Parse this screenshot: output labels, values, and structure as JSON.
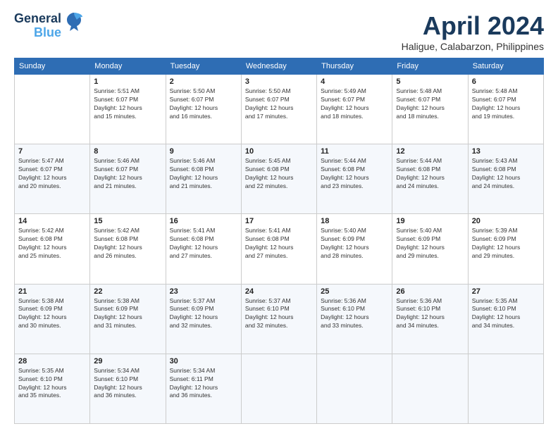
{
  "logo": {
    "line1": "General",
    "line2": "Blue"
  },
  "title": "April 2024",
  "subtitle": "Haligue, Calabarzon, Philippines",
  "headers": [
    "Sunday",
    "Monday",
    "Tuesday",
    "Wednesday",
    "Thursday",
    "Friday",
    "Saturday"
  ],
  "rows": [
    [
      {
        "day": "",
        "info": ""
      },
      {
        "day": "1",
        "info": "Sunrise: 5:51 AM\nSunset: 6:07 PM\nDaylight: 12 hours\nand 15 minutes."
      },
      {
        "day": "2",
        "info": "Sunrise: 5:50 AM\nSunset: 6:07 PM\nDaylight: 12 hours\nand 16 minutes."
      },
      {
        "day": "3",
        "info": "Sunrise: 5:50 AM\nSunset: 6:07 PM\nDaylight: 12 hours\nand 17 minutes."
      },
      {
        "day": "4",
        "info": "Sunrise: 5:49 AM\nSunset: 6:07 PM\nDaylight: 12 hours\nand 18 minutes."
      },
      {
        "day": "5",
        "info": "Sunrise: 5:48 AM\nSunset: 6:07 PM\nDaylight: 12 hours\nand 18 minutes."
      },
      {
        "day": "6",
        "info": "Sunrise: 5:48 AM\nSunset: 6:07 PM\nDaylight: 12 hours\nand 19 minutes."
      }
    ],
    [
      {
        "day": "7",
        "info": "Sunrise: 5:47 AM\nSunset: 6:07 PM\nDaylight: 12 hours\nand 20 minutes."
      },
      {
        "day": "8",
        "info": "Sunrise: 5:46 AM\nSunset: 6:07 PM\nDaylight: 12 hours\nand 21 minutes."
      },
      {
        "day": "9",
        "info": "Sunrise: 5:46 AM\nSunset: 6:08 PM\nDaylight: 12 hours\nand 21 minutes."
      },
      {
        "day": "10",
        "info": "Sunrise: 5:45 AM\nSunset: 6:08 PM\nDaylight: 12 hours\nand 22 minutes."
      },
      {
        "day": "11",
        "info": "Sunrise: 5:44 AM\nSunset: 6:08 PM\nDaylight: 12 hours\nand 23 minutes."
      },
      {
        "day": "12",
        "info": "Sunrise: 5:44 AM\nSunset: 6:08 PM\nDaylight: 12 hours\nand 24 minutes."
      },
      {
        "day": "13",
        "info": "Sunrise: 5:43 AM\nSunset: 6:08 PM\nDaylight: 12 hours\nand 24 minutes."
      }
    ],
    [
      {
        "day": "14",
        "info": "Sunrise: 5:42 AM\nSunset: 6:08 PM\nDaylight: 12 hours\nand 25 minutes."
      },
      {
        "day": "15",
        "info": "Sunrise: 5:42 AM\nSunset: 6:08 PM\nDaylight: 12 hours\nand 26 minutes."
      },
      {
        "day": "16",
        "info": "Sunrise: 5:41 AM\nSunset: 6:08 PM\nDaylight: 12 hours\nand 27 minutes."
      },
      {
        "day": "17",
        "info": "Sunrise: 5:41 AM\nSunset: 6:08 PM\nDaylight: 12 hours\nand 27 minutes."
      },
      {
        "day": "18",
        "info": "Sunrise: 5:40 AM\nSunset: 6:09 PM\nDaylight: 12 hours\nand 28 minutes."
      },
      {
        "day": "19",
        "info": "Sunrise: 5:40 AM\nSunset: 6:09 PM\nDaylight: 12 hours\nand 29 minutes."
      },
      {
        "day": "20",
        "info": "Sunrise: 5:39 AM\nSunset: 6:09 PM\nDaylight: 12 hours\nand 29 minutes."
      }
    ],
    [
      {
        "day": "21",
        "info": "Sunrise: 5:38 AM\nSunset: 6:09 PM\nDaylight: 12 hours\nand 30 minutes."
      },
      {
        "day": "22",
        "info": "Sunrise: 5:38 AM\nSunset: 6:09 PM\nDaylight: 12 hours\nand 31 minutes."
      },
      {
        "day": "23",
        "info": "Sunrise: 5:37 AM\nSunset: 6:09 PM\nDaylight: 12 hours\nand 32 minutes."
      },
      {
        "day": "24",
        "info": "Sunrise: 5:37 AM\nSunset: 6:10 PM\nDaylight: 12 hours\nand 32 minutes."
      },
      {
        "day": "25",
        "info": "Sunrise: 5:36 AM\nSunset: 6:10 PM\nDaylight: 12 hours\nand 33 minutes."
      },
      {
        "day": "26",
        "info": "Sunrise: 5:36 AM\nSunset: 6:10 PM\nDaylight: 12 hours\nand 34 minutes."
      },
      {
        "day": "27",
        "info": "Sunrise: 5:35 AM\nSunset: 6:10 PM\nDaylight: 12 hours\nand 34 minutes."
      }
    ],
    [
      {
        "day": "28",
        "info": "Sunrise: 5:35 AM\nSunset: 6:10 PM\nDaylight: 12 hours\nand 35 minutes."
      },
      {
        "day": "29",
        "info": "Sunrise: 5:34 AM\nSunset: 6:10 PM\nDaylight: 12 hours\nand 36 minutes."
      },
      {
        "day": "30",
        "info": "Sunrise: 5:34 AM\nSunset: 6:11 PM\nDaylight: 12 hours\nand 36 minutes."
      },
      {
        "day": "",
        "info": ""
      },
      {
        "day": "",
        "info": ""
      },
      {
        "day": "",
        "info": ""
      },
      {
        "day": "",
        "info": ""
      }
    ]
  ]
}
